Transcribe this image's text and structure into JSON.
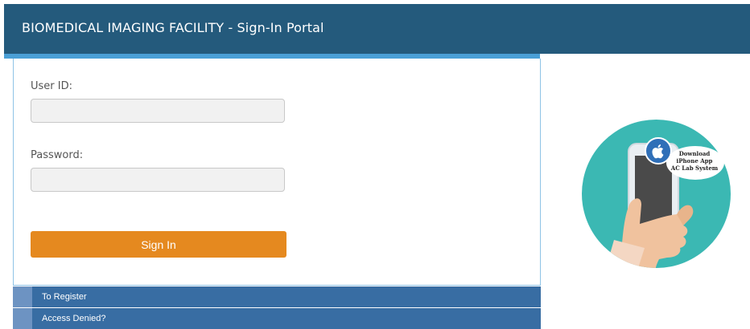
{
  "header": {
    "title": "BIOMEDICAL IMAGING FACILITY - Sign-In Portal"
  },
  "form": {
    "user_id_label": "User ID:",
    "user_id_value": "",
    "password_label": "Password:",
    "password_value": "",
    "sign_in_label": "Sign In"
  },
  "nav": {
    "items": [
      {
        "label": "To Register"
      },
      {
        "label": "Access Denied?"
      }
    ]
  },
  "promo": {
    "lines": [
      "Download",
      "iPhone App",
      "AC Lab System"
    ],
    "icon": "apple-icon"
  },
  "colors": {
    "header": "#245a7c",
    "accent": "#4a9fd6",
    "button": "#e5891f",
    "nav": "#386da3",
    "promo": "#3bb8b3"
  }
}
